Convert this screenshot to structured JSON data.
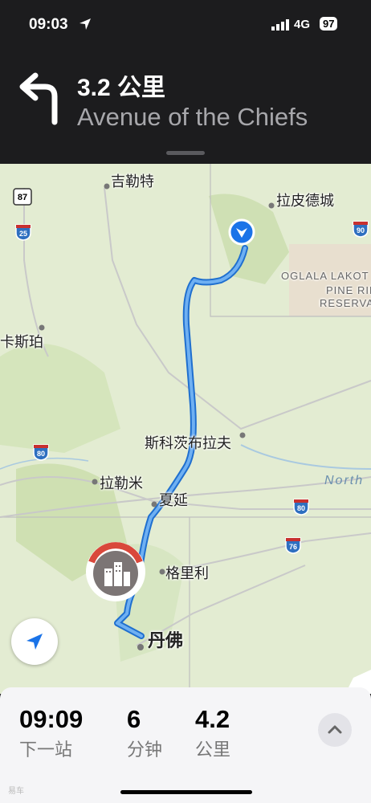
{
  "status": {
    "time": "09:03",
    "network": "4G",
    "battery": "97"
  },
  "navigation": {
    "distance": "3.2 公里",
    "street": "Avenue of the Chiefs"
  },
  "map": {
    "labels": {
      "gillette": "吉勒特",
      "rapid_city": "拉皮德城",
      "casper": "卡斯珀",
      "scottsbluff": "斯科茨布拉夫",
      "laramie": "拉勒米",
      "cheyenne": "夏延",
      "greeley": "格里利",
      "denver": "丹佛",
      "reservation_1": "OGLALA LAKOT",
      "reservation_2": "PINE RIDG",
      "reservation_3": "RESERVATIO",
      "river": "North"
    },
    "shields": {
      "us87": "87",
      "i25": "25",
      "i90": "90",
      "i80a": "80",
      "i80b": "80",
      "i76": "76"
    },
    "route_color": "#4a90e2",
    "land_color": "#e3ecd2"
  },
  "summary": {
    "arrival_time": "09:09",
    "arrival_label": "下一站",
    "minutes": "6",
    "minutes_label": "分钟",
    "distance": "4.2",
    "distance_label": "公里"
  },
  "watermark": "易车"
}
